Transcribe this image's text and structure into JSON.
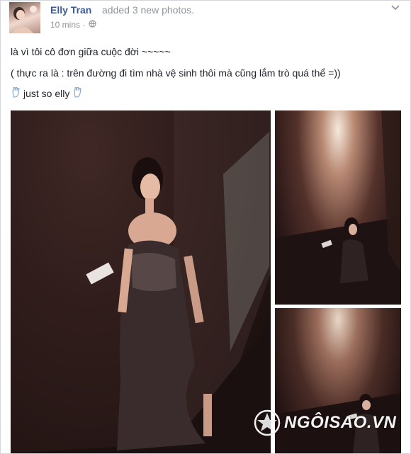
{
  "post": {
    "author": "Elly Tran",
    "action": "added 3 new photos.",
    "time": "10 mins",
    "lines": [
      "là vì tôi cô đơn giữa cuộc đời ~~~~~",
      "( thực ra là : trên đường đi tìm nhà vệ sinh thôi mà cũng lắm trò quá thể =))",
      "just so elly"
    ]
  },
  "icons": {
    "privacy": "globe-icon",
    "menu": "chevron-down-icon",
    "emoji": "hand-emoji-icon"
  },
  "photos": [
    "photo-1",
    "photo-2",
    "photo-3"
  ],
  "watermark": {
    "text": "NGÔISAO.VN"
  },
  "colors": {
    "author_link": "#3b5998",
    "meta_text": "#90949c",
    "body_text": "#1d2129"
  }
}
